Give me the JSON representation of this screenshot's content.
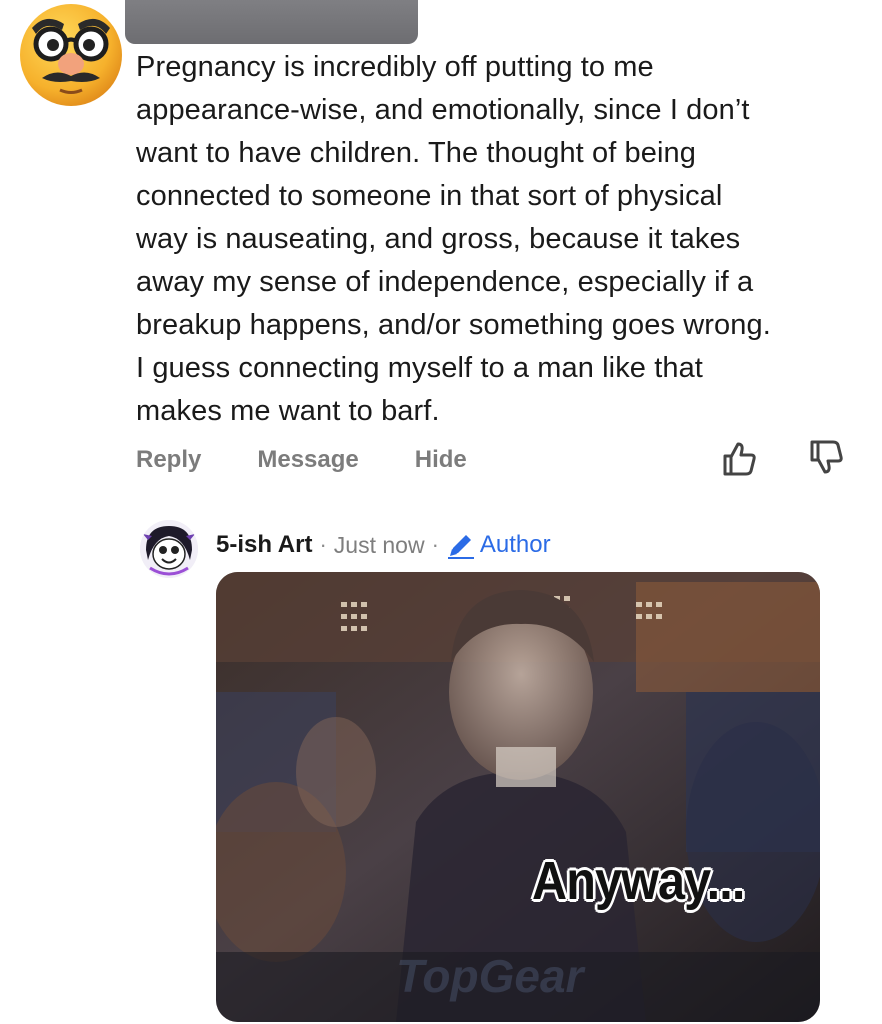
{
  "comment": {
    "text": "Pregnancy is incredibly off putting to me\nappearance-wise, and emotionally, since I don’t\nwant to have children. The thought of being\nconnected to someone in that sort of physical\nway is nauseating, and gross, because it takes\naway my sense of independence, especially if a\nbreakup happens, and/or something goes wrong.\nI guess connecting myself to a man like that\nmakes me want to barf.",
    "avatar_icon": "disguise-face-emoji",
    "actions": {
      "reply_label": "Reply",
      "message_label": "Message",
      "hide_label": "Hide"
    },
    "vote_icons": [
      "thumbs-up-icon",
      "thumbs-down-icon"
    ]
  },
  "reply": {
    "author": "5-ish Art",
    "separator": "·",
    "time": "Just now",
    "badge_label": "Author",
    "badge_icon": "pencil-icon",
    "badge_color": "#2b6be6",
    "gif_caption": "Anyway..."
  }
}
